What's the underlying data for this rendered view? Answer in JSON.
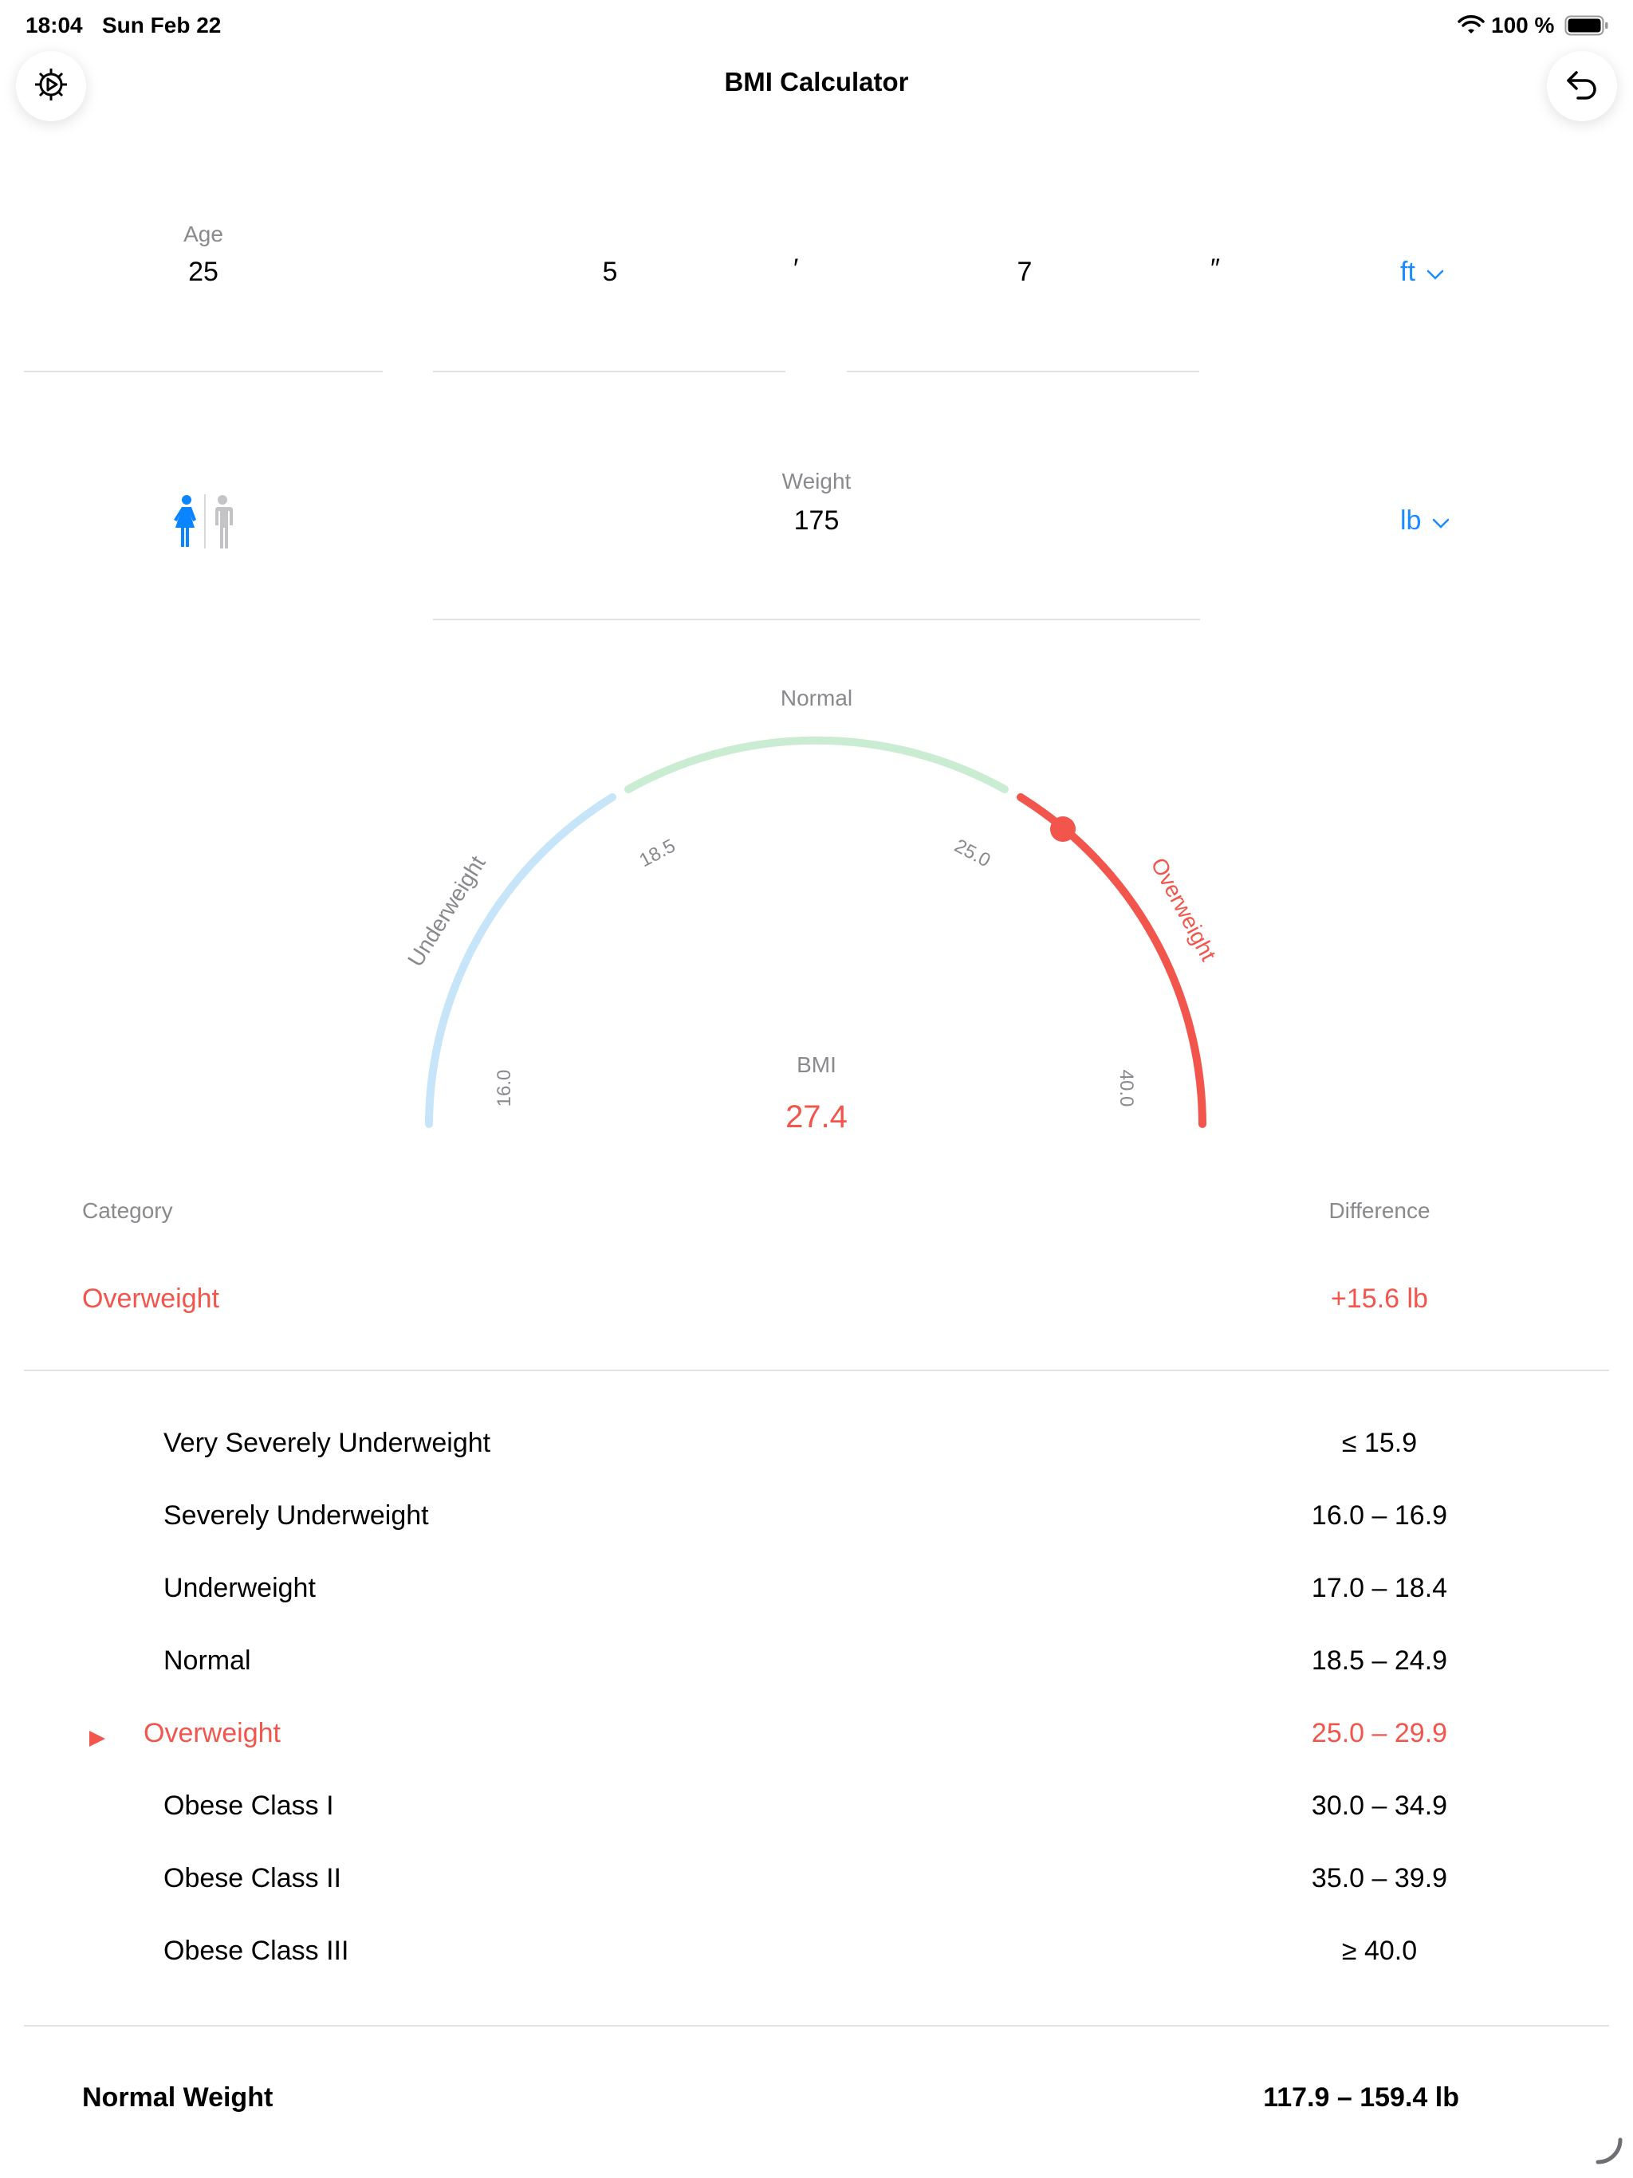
{
  "status_bar": {
    "time": "18:04",
    "date": "Sun Feb 22",
    "battery": "100 %"
  },
  "header": {
    "title": "BMI Calculator",
    "settings_icon": "gear-icon",
    "undo_icon": "undo-arrow-icon"
  },
  "inputs": {
    "age_label": "Age",
    "age_value": "25",
    "height_feet": "5",
    "feet_mark": "′",
    "height_inches": "7",
    "inch_mark": "″",
    "height_unit": "ft",
    "weight_label": "Weight",
    "weight_value": "175",
    "weight_unit": "lb",
    "gender_selected": "female"
  },
  "gauge": {
    "normal_label": "Normal",
    "underweight_label": "Underweight",
    "overweight_label": "Overweight",
    "tick_16": "16.0",
    "tick_18_5": "18.5",
    "tick_25": "25.0",
    "tick_40": "40.0",
    "bmi_label": "BMI",
    "bmi_value": "27.4",
    "colors": {
      "underweight": "#c6e5f8",
      "normal": "#c9ecd3",
      "overweight": "#f2554b"
    }
  },
  "result": {
    "category_header": "Category",
    "difference_header": "Difference",
    "category_value": "Overweight",
    "difference_value": "+15.6 lb"
  },
  "ranges": [
    {
      "name": "Very Severely Underweight",
      "range": "≤ 15.9"
    },
    {
      "name": "Severely Underweight",
      "range": "16.0 – 16.9"
    },
    {
      "name": "Underweight",
      "range": "17.0 – 18.4"
    },
    {
      "name": "Normal",
      "range": "18.5 – 24.9"
    },
    {
      "name": "Overweight",
      "range": "25.0 – 29.9"
    },
    {
      "name": "Obese Class I",
      "range": "30.0 – 34.9"
    },
    {
      "name": "Obese Class II",
      "range": "35.0 – 39.9"
    },
    {
      "name": "Obese Class III",
      "range": "≥ 40.0"
    }
  ],
  "normal_weight": {
    "label": "Normal Weight",
    "value": "117.9 – 159.4 lb"
  }
}
